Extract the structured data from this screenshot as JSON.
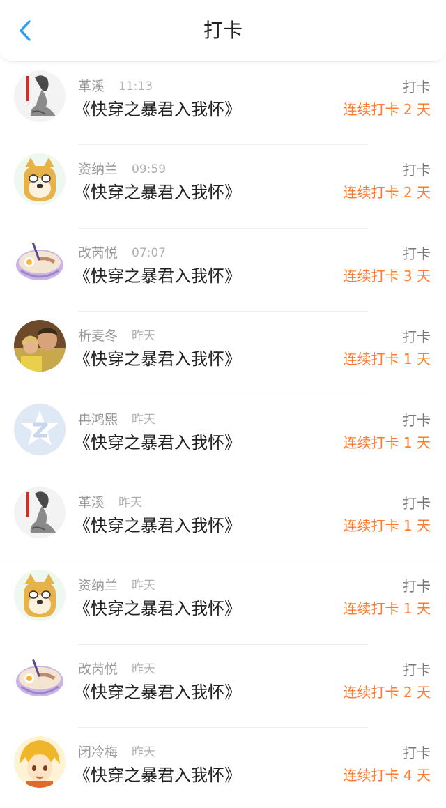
{
  "header": {
    "title": "打卡",
    "back_icon": "chevron-left-icon",
    "accent": "#2a9df4"
  },
  "colors": {
    "streak": "#ff7a2e",
    "name": "#9a9a9a",
    "title": "#222222"
  },
  "items": [
    {
      "name": "革溪",
      "time": "11:13",
      "book": "《快穿之暴君入我怀》",
      "action": "打卡",
      "streak": "连续打卡 2 天",
      "avatar": "girl-sketch-avatar"
    },
    {
      "name": "资纳兰",
      "time": "09:59",
      "book": "《快穿之暴君入我怀》",
      "action": "打卡",
      "streak": "连续打卡 2 天",
      "avatar": "shiba-dog-avatar"
    },
    {
      "name": "改芮悦",
      "time": "07:07",
      "book": "《快穿之暴君入我怀》",
      "action": "打卡",
      "streak": "连续打卡 3 天",
      "avatar": "ramen-bowl-avatar"
    },
    {
      "name": "析麦冬",
      "time": "昨天",
      "book": "《快穿之暴君入我怀》",
      "action": "打卡",
      "streak": "连续打卡 1 天",
      "avatar": "couple-photo-avatar"
    },
    {
      "name": "冉鸿熙",
      "time": "昨天",
      "book": "《快穿之暴君入我怀》",
      "action": "打卡",
      "streak": "连续打卡 1 天",
      "avatar": "default-qq-avatar"
    },
    {
      "name": "革溪",
      "time": "昨天",
      "book": "《快穿之暴君入我怀》",
      "action": "打卡",
      "streak": "连续打卡 1 天",
      "avatar": "girl-sketch-avatar"
    },
    {
      "name": "资纳兰",
      "time": "昨天",
      "book": "《快穿之暴君入我怀》",
      "action": "打卡",
      "streak": "连续打卡 1 天",
      "avatar": "shiba-dog-avatar"
    },
    {
      "name": "改芮悦",
      "time": "昨天",
      "book": "《快穿之暴君入我怀》",
      "action": "打卡",
      "streak": "连续打卡 2 天",
      "avatar": "ramen-bowl-avatar"
    },
    {
      "name": "闭冷梅",
      "time": "昨天",
      "book": "《快穿之暴君入我怀》",
      "action": "打卡",
      "streak": "连续打卡 4 天",
      "avatar": "anime-boy-avatar"
    }
  ]
}
